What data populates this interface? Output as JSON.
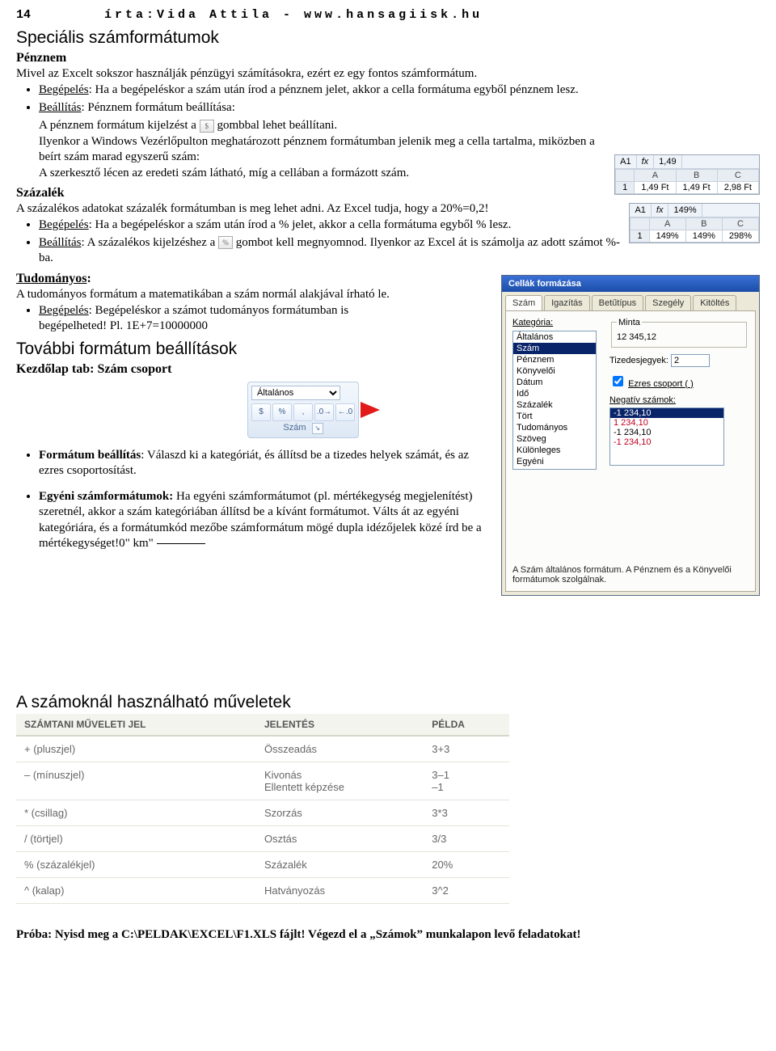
{
  "header": {
    "page_num": "14",
    "credit": "írta:Vida Attila - www.hansagiisk.hu"
  },
  "s1": {
    "title": "Speciális számformátumok",
    "penznem": {
      "label": "Pénznem",
      "intro": "Mivel az Excelt sokszor használják pénzügyi számításokra, ezért ez egy fontos számformátum.",
      "b1_pre": "Begépelés",
      "b1_txt": ": Ha a begépeléskor a szám után írod a pénznem jelet, akkor a cella formátuma egyből pénznem lesz.",
      "b2_pre": "Beállítás",
      "b2_txt": ": Pénznem formátum beállítása:",
      "line_a_pre": "A pénznem formátum kijelzést a ",
      "line_a_post": " gombbal lehet beállítani.",
      "line_b": "Ilyenkor a Windows Vezérlőpulton meghatározott pénznem formátumban jelenik meg a cella tartalma, miközben a beírt szám marad egyszerű szám:",
      "line_c": "A szerkesztő lécen az eredeti szám látható, míg a cellában a formázott szám."
    },
    "szazalek": {
      "label": "Százalék",
      "intro": "A százalékos adatokat százalék formátumban is meg lehet adni. Az Excel tudja, hogy a 20%=0,2!",
      "b1_pre": "Begépelés",
      "b1_txt": ": Ha a begépeléskor a szám után írod a % jelet, akkor a cella formátuma egyből % lesz.",
      "b2_pre": "Beállítás",
      "b2_txt_a": ": A százalékos kijelzéshez a ",
      "b2_txt_b": " gombot kell megnyomnod. Ilyenkor az Excel át is számolja az adott számot %-ba."
    },
    "tudomanyos": {
      "label": "Tudományos",
      "intro": "A tudományos formátum a matematikában a szám normál alakjával írható le.",
      "b1_pre": "Begépelés",
      "b1_txt": ": Begépeléskor a számot tudományos formátumban is begépelheted! Pl. 1E+7=10000000"
    }
  },
  "s2": {
    "title": "További formátum beállítások",
    "sub": "Kezdőlap tab: Szám csoport",
    "ribbon_select": "Általános",
    "ribbon_grp": "Szám",
    "b1_pre": "Formátum beállítás",
    "b1_txt": ": Válaszd ki a kategóriát, és állítsd be a tizedes helyek számát, és az ezres csoportosítást.",
    "b2_pre": "Egyéni számformátumok:",
    "b2_txt": " Ha egyéni számformátumot (pl. mértékegység megjelenítést) szeretnél, akkor a szám kategóriában állítsd be a kívánt formátumot. Válts át az egyéni kategóriára, és a formátumkód mezőbe számformátum mögé dupla idézőjelek közé írd be a mértékegységet!0\" km\""
  },
  "mini1": {
    "ref": "A1",
    "fx": "1,49",
    "a": "1,49 Ft",
    "b": "1,49 Ft",
    "c": "2,98 Ft"
  },
  "mini2": {
    "ref": "A1",
    "fx": "149%",
    "a": "149%",
    "b": "149%",
    "c": "298%"
  },
  "dlg": {
    "title": "Cellák formázása",
    "tabs": [
      "Szám",
      "Igazítás",
      "Betűtípus",
      "Szegély",
      "Kitöltés"
    ],
    "cat_label": "Kategória:",
    "cats": [
      "Általános",
      "Szám",
      "Pénznem",
      "Könyvelői",
      "Dátum",
      "Idő",
      "Százalék",
      "Tört",
      "Tudományos",
      "Szöveg",
      "Különleges",
      "Egyéni"
    ],
    "sample_grp": "Minta",
    "sample_val": "12 345,12",
    "dec_label": "Tizedesjegyek:",
    "dec_val": "2",
    "thou_label": "Ezres csoport ( )",
    "neg_label": "Negatív számok:",
    "neg": [
      "-1 234,10",
      "1 234,10",
      "-1 234,10",
      "-1 234,10"
    ],
    "foot": "A Szám általános formátum. A Pénznem és a Könyvelői formátumok szolgálnak."
  },
  "s3": {
    "title": "A számoknál használható műveletek"
  },
  "optable": {
    "h1": "SZÁMTANI MŰVELETI JEL",
    "h2": "JELENTÉS",
    "h3": "PÉLDA",
    "rows": [
      {
        "a": "+ (pluszjel)",
        "b": "Összeadás",
        "c": "3+3"
      },
      {
        "a": "– (mínuszjel)",
        "b": "Kivonás\nEllentett képzése",
        "c": "3–1\n–1"
      },
      {
        "a": "* (csillag)",
        "b": "Szorzás",
        "c": "3*3"
      },
      {
        "a": "/ (törtjel)",
        "b": "Osztás",
        "c": "3/3"
      },
      {
        "a": "% (százalékjel)",
        "b": "Százalék",
        "c": "20%"
      },
      {
        "a": "^ (kalap)",
        "b": "Hatványozás",
        "c": "3^2"
      }
    ]
  },
  "try": "Próba: Nyisd meg a C:\\PELDAK\\EXCEL\\F1.XLS fájlt! Végezd el a „Számok” munkalapon levő feladatokat!",
  "icons": {
    "currency": "$",
    "percent": "%"
  }
}
